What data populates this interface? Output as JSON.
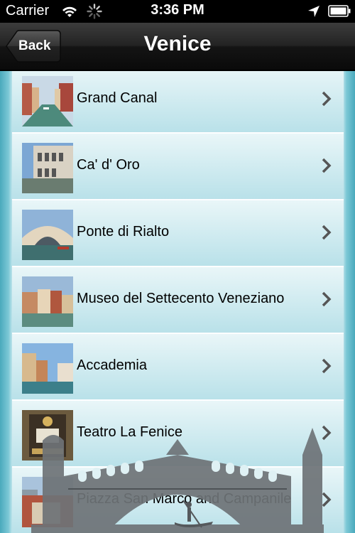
{
  "status_bar": {
    "carrier": "Carrier",
    "time": "3:36 PM"
  },
  "nav": {
    "back_label": "Back",
    "title": "Venice"
  },
  "places": [
    {
      "name": "Grand Canal",
      "thumb": "grand-canal-photo"
    },
    {
      "name": "Ca' d' Oro",
      "thumb": "ca-doro-photo"
    },
    {
      "name": "Ponte di Rialto",
      "thumb": "rialto-bridge-photo"
    },
    {
      "name": "Museo del Settecento Veneziano",
      "thumb": "museo-photo"
    },
    {
      "name": "Accademia",
      "thumb": "accademia-photo"
    },
    {
      "name": "Teatro La Fenice",
      "thumb": "la-fenice-photo"
    },
    {
      "name": "Piazza San Marco and Campanile",
      "thumb": "san-marco-photo"
    }
  ],
  "colors": {
    "navbar": "#1c1c1c",
    "row_top": "#e9f6f8",
    "row_bottom": "#b9e1e9",
    "chevron": "#555555",
    "bridge_watermark": "#6e7377"
  }
}
